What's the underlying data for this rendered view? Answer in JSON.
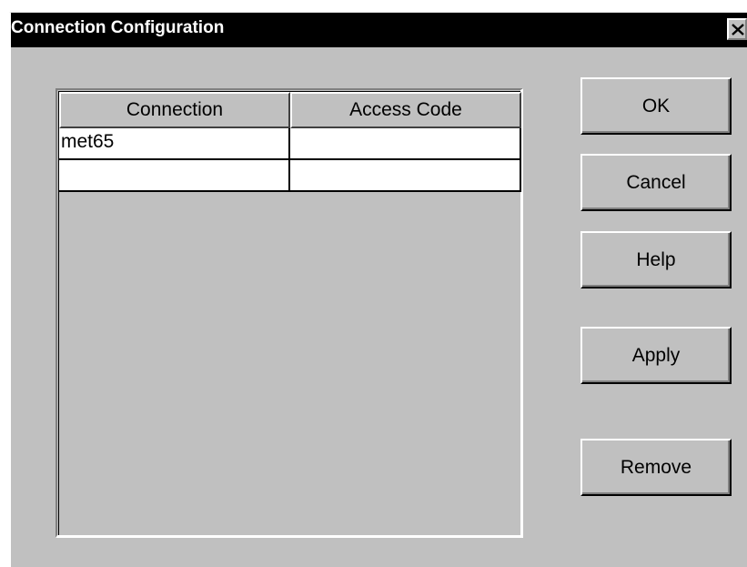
{
  "window": {
    "title": "Connection Configuration"
  },
  "table": {
    "columns": [
      "Connection",
      "Access Code"
    ],
    "rows": [
      {
        "connection": "met65",
        "access_code": ""
      },
      {
        "connection": "",
        "access_code": ""
      }
    ]
  },
  "buttons": {
    "ok": "OK",
    "cancel": "Cancel",
    "help": "Help",
    "apply": "Apply",
    "remove": "Remove"
  },
  "icons": {
    "close": "close-icon"
  },
  "colors": {
    "titlebar": "#000000",
    "dialog_face": "#c0c0c0"
  }
}
